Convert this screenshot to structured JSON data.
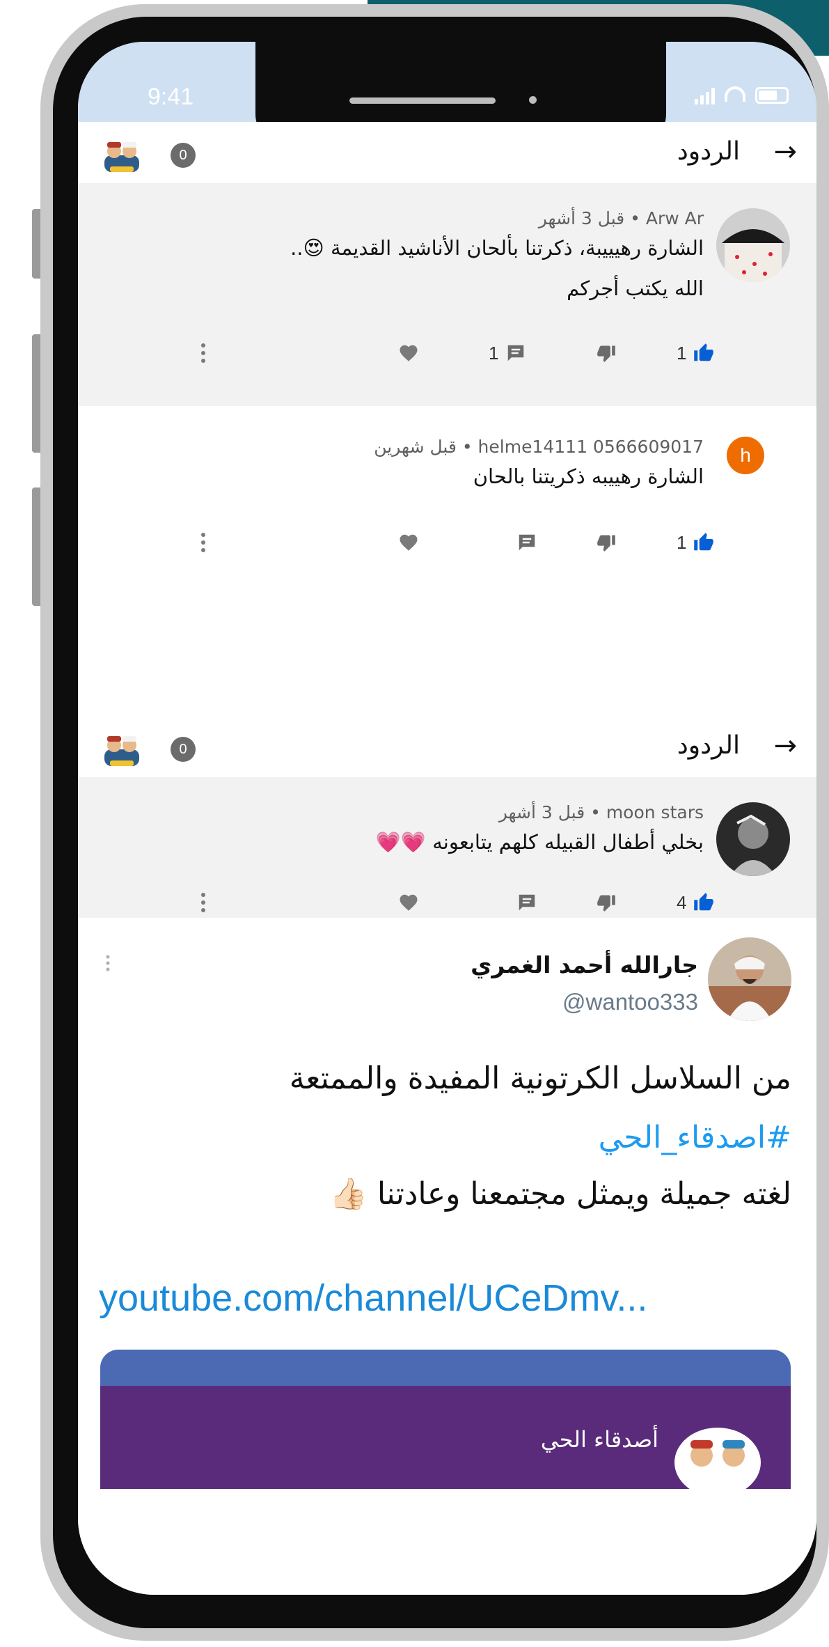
{
  "status": {
    "time": "9:41"
  },
  "colors": {
    "accent_like": "#065fd4",
    "hashtag": "#1d9bf0",
    "link": "#1a8ad8",
    "badge": "#6b6b6b"
  },
  "headers": [
    {
      "title": "الردود",
      "count": "0",
      "back_icon": "arrow-right-icon"
    },
    {
      "title": "الردود",
      "count": "0",
      "back_icon": "arrow-right-icon"
    }
  ],
  "comments": [
    {
      "meta": "Arw Ar • قبل 3 أشهر",
      "lines": [
        "الشارة رهيييبة، ذكرتنا بألحان الأناشيد القديمة 😍..",
        "الله يكتب أجركم"
      ],
      "likes": "1",
      "replies": "1"
    },
    {
      "meta": "helme14111 0566609017 • قبل شهرين",
      "avatar_letter": "h",
      "lines": [
        "الشارة رهييبه ذكريتنا بالحان"
      ],
      "likes": "1",
      "replies": ""
    },
    {
      "meta": "moon stars • قبل 3 أشهر",
      "lines": [
        "بخلي أطفال القبيله كلهم يتابعونه 💗💗"
      ],
      "likes": "4",
      "replies": ""
    }
  ],
  "tweet": {
    "name": "جارالله أحمد الغمري",
    "handle": "@wantoo333",
    "line1": "من السلاسل الكرتونية المفيدة والممتعة",
    "hashtag": "#اصدقاء_الحي",
    "line3": "لغته جميلة ويمثل مجتمعنا وعادتنا 👍🏻",
    "link": "youtube.com/channel/UCeDmv...",
    "preview_title": "أصدقاء الحي"
  }
}
